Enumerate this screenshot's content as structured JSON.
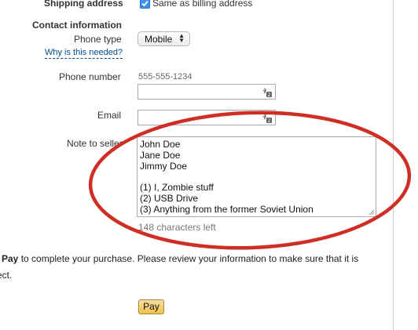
{
  "shipping": {
    "label": "Shipping address",
    "same_as_billing_label": "Same as billing address",
    "same_as_billing_checked": true
  },
  "contact": {
    "section_title": "Contact information",
    "phone_type_label": "Phone type",
    "phone_type_value": "Mobile",
    "why_link": "Why is this needed?",
    "phone_number_label": "Phone number",
    "phone_number_hint": "555-555-1234",
    "phone_number_value": "",
    "email_label": "Email",
    "email_value": "",
    "note_label": "Note to seller",
    "note_lines": [
      "John Doe",
      "Jane Doe",
      "Jimmy Doe",
      "",
      "(1) I, Zombie stuff",
      "(2) USB Drive",
      "(3) Anything from the former Soviet Union"
    ],
    "chars_left": "148 characters left"
  },
  "instructions": {
    "line1_bold": "Pay",
    "line1_rest": " to complete your purchase. Please review your information to make sure that it is",
    "line2": "ect."
  },
  "pay_button_label": "Pay",
  "icons": {
    "checkbox": "checkmark-icon",
    "field_helper": "field-helper-icon",
    "select_arrows": "up-down-arrows-icon",
    "resize": "resize-grip-icon"
  },
  "colors": {
    "annotation_ring": "#cf2e24",
    "link": "#004b91",
    "checkbox": "#3b8eed",
    "pay_button": "#f0c14b"
  }
}
